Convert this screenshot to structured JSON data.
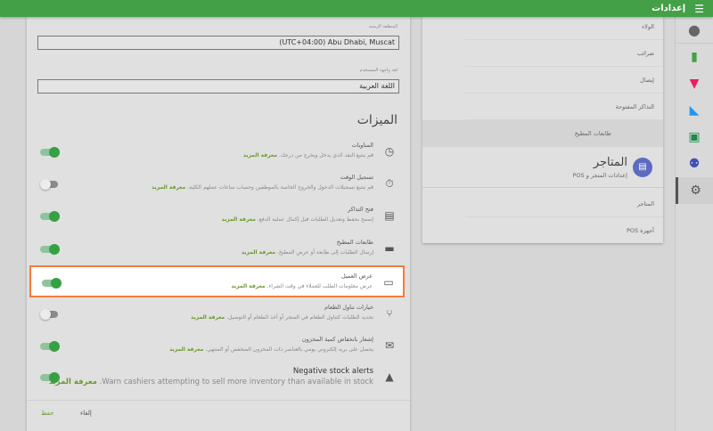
{
  "header": {
    "title": "إعدادات",
    "menu_icon": "hamburger-icon",
    "color": "#43a047"
  },
  "rail": [
    "account-icon",
    "reports-icon",
    "items-icon",
    "inventory-icon",
    "customers-icon",
    "employees-icon",
    "settings-icon"
  ],
  "general": {
    "timezone_label": "المنطقة الزمنية",
    "timezone_value": "(UTC+04:00) Abu Dhabi, Muscat",
    "language_label": "لغة واجهة المستخدم",
    "language_value": "اللغة العربية"
  },
  "features": {
    "title": "الميزات",
    "learn_more": "معرفة المزيد",
    "items": [
      {
        "title": "المناوبات",
        "desc": "قم بتتبع النقد الذي يدخل ويخرج من درجك.",
        "on": true,
        "icon": "clock-icon"
      },
      {
        "title": "تسجيل الوقت",
        "desc": "قم بتتبع تسجيلات الدخول والخروج الخاصة بالموظفين وحساب ساعات عملهم الكلية.",
        "on": false,
        "icon": "stopwatch-icon"
      },
      {
        "title": "فتح التذاكر",
        "desc": "إسمح بحفظ وتعديل الطلبات قبل إكمال عملية الدفع.",
        "on": true,
        "icon": "open-ticket-icon"
      },
      {
        "title": "طابعات المطبخ",
        "desc": "إرسال الطلبات إلى طابعة أو عرض المطبخ.",
        "on": true,
        "icon": "printer-icon"
      },
      {
        "title": "عرض العميل",
        "desc": "عرض معلومات الطلب للعملاء في وقت الشراء.",
        "on": true,
        "icon": "display-icon",
        "highlighted": true
      },
      {
        "title": "خيارات تناول الطعام",
        "desc": "تحديد الطلبات كتناول الطعام في المتجر أو أخذ الطعام أو التوصيل.",
        "on": false,
        "icon": "dining-icon"
      },
      {
        "title": "إشعار بانخفاض كمية المخزون",
        "desc": "يحصل على بريد إلكتروني يومي بالعناصر ذات المخزون المنخفض أو المنتهي.",
        "on": true,
        "icon": "mail-icon"
      },
      {
        "title": "Negative stock alerts",
        "desc": "Warn cashiers attempting to sell more inventory than available in stock.",
        "on": true,
        "icon": "stock-alert-icon",
        "en": true
      }
    ]
  },
  "footer": {
    "cancel": "إلغاء",
    "save": "حفظ"
  },
  "settings_nav": {
    "items": [
      "الولاء",
      "ضرائب",
      "إيصال",
      "التذاكر المفتوحة",
      "طابعات المطبخ"
    ],
    "selected": 4,
    "stores_title": "المتاجر",
    "stores_subtitle": "إعدادات المتجر و POS",
    "store_items": [
      "المتاجر",
      "أجهزة POS"
    ]
  }
}
